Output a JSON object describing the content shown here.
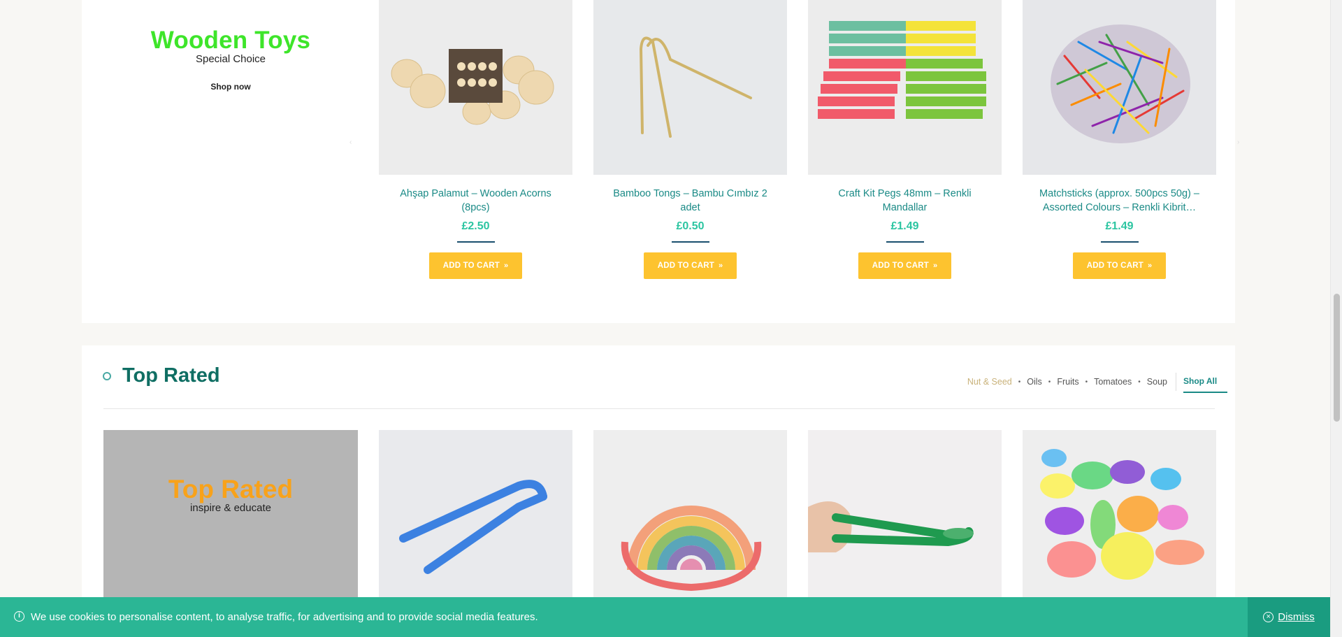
{
  "promo_top": {
    "title": "Wooden Toys",
    "subtitle": "Special Choice",
    "link": "Shop now",
    "title_color": "#3ee52a"
  },
  "products_top": [
    {
      "name": "Ahşap Palamut – Wooden Acorns (8pcs)",
      "price": "£2.50",
      "button": "ADD TO CART",
      "icon": "acorns-image"
    },
    {
      "name": "Bamboo Tongs – Bambu Cımbız 2 adet",
      "price": "£0.50",
      "button": "ADD TO CART",
      "icon": "tongs-image"
    },
    {
      "name": "Craft Kit Pegs 48mm – Renkli Mandallar",
      "price": "£1.49",
      "button": "ADD TO CART",
      "icon": "pegs-image"
    },
    {
      "name": "Matchsticks (approx. 500pcs 50g) – Assorted Colours – Renkli Kibrit…",
      "price": "£1.49",
      "button": "ADD TO CART",
      "icon": "matchsticks-image"
    }
  ],
  "section": {
    "title": "Top Rated",
    "filters": [
      "Nut & Seed",
      "Oils",
      "Fruits",
      "Tomatoes",
      "Soup"
    ],
    "active_filter": "Nut & Seed",
    "shop_all": "Shop All"
  },
  "promo_bottom": {
    "title": "Top Rated",
    "subtitle": "inspire & educate",
    "title_color": "#f8a21a"
  },
  "products_bottom": [
    {
      "icon": "blue-tweezers-image"
    },
    {
      "icon": "rainbow-stacker-image"
    },
    {
      "icon": "green-tweezers-image"
    },
    {
      "icon": "translucent-stones-image"
    }
  ],
  "cookie": {
    "message": "We use cookies to personalise content, to analyse traffic, for advertising and to provide social media features.",
    "dismiss": "Dismiss"
  },
  "colors": {
    "accent": "#2bb695",
    "button": "#fdc32f",
    "price": "#2cc5a1",
    "name": "#1a8a86"
  }
}
